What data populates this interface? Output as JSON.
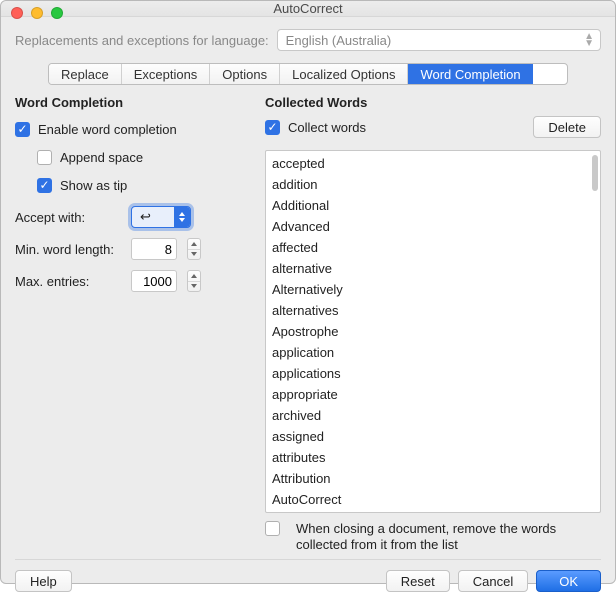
{
  "window": {
    "title": "AutoCorrect"
  },
  "language": {
    "label": "Replacements and exceptions for language:",
    "value": "English (Australia)"
  },
  "tabs": {
    "replace": "Replace",
    "exceptions": "Exceptions",
    "options": "Options",
    "localized": "Localized Options",
    "word_completion": "Word Completion"
  },
  "word_completion": {
    "header": "Word Completion",
    "enable": "Enable word completion",
    "append_space": "Append space",
    "show_as_tip": "Show as tip",
    "accept_with_label": "Accept with:",
    "accept_with_value": "↩",
    "min_len_label": "Min. word length:",
    "min_len_value": "8",
    "max_entries_label": "Max. entries:",
    "max_entries_value": "1000"
  },
  "collected": {
    "header": "Collected Words",
    "collect": "Collect words",
    "delete": "Delete",
    "closing_note": "When closing a document, remove the words collected from it from the list",
    "words": [
      "accepted",
      "addition",
      "Additional",
      "Advanced",
      "affected",
      "alternative",
      "Alternatively",
      "alternatives",
      "Apostrophe",
      "application",
      "applications",
      "appropriate",
      "archived",
      "assigned",
      "attributes",
      "Attribution",
      "AutoCorrect"
    ]
  },
  "footer": {
    "help": "Help",
    "reset": "Reset",
    "cancel": "Cancel",
    "ok": "OK"
  }
}
